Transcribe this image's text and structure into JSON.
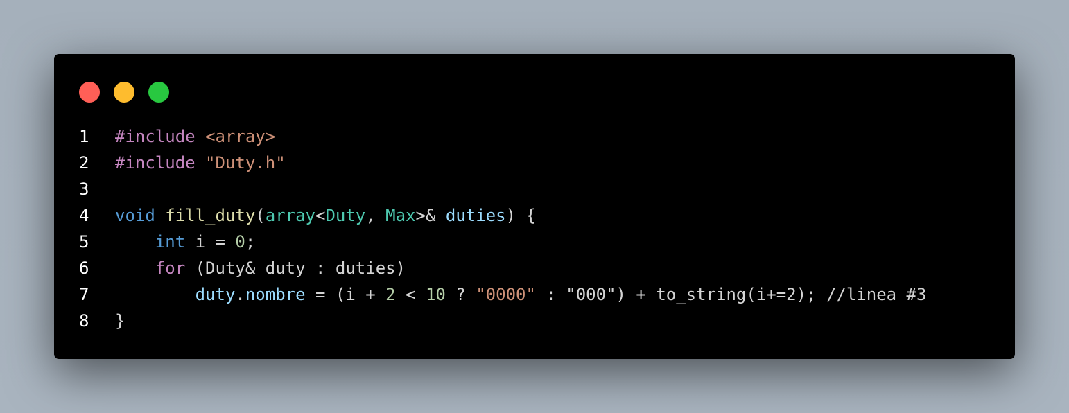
{
  "window": {
    "buttons": {
      "close_color": "#ff5f57",
      "minimize_color": "#febc2e",
      "maximize_color": "#28c840"
    }
  },
  "code": {
    "lines": [
      {
        "number": "1",
        "tokens": [
          {
            "text": "#include ",
            "color": "#c586c0"
          },
          {
            "text": "<array>",
            "color": "#ce9178"
          }
        ]
      },
      {
        "number": "2",
        "tokens": [
          {
            "text": "#include ",
            "color": "#c586c0"
          },
          {
            "text": "\"Duty.h\"",
            "color": "#ce9178"
          }
        ]
      },
      {
        "number": "3",
        "tokens": []
      },
      {
        "number": "4",
        "tokens": [
          {
            "text": "void",
            "color": "#569cd6"
          },
          {
            "text": " ",
            "color": "#d4d4d4"
          },
          {
            "text": "fill_duty",
            "color": "#dcdcaa"
          },
          {
            "text": "(",
            "color": "#d4d4d4"
          },
          {
            "text": "array",
            "color": "#4ec9b0"
          },
          {
            "text": "<",
            "color": "#d4d4d4"
          },
          {
            "text": "Duty",
            "color": "#4ec9b0"
          },
          {
            "text": ", ",
            "color": "#d4d4d4"
          },
          {
            "text": "Max",
            "color": "#4ec9b0"
          },
          {
            "text": ">&",
            "color": "#d4d4d4"
          },
          {
            "text": " ",
            "color": "#d4d4d4"
          },
          {
            "text": "duties",
            "color": "#9cdcfe"
          },
          {
            "text": ") {",
            "color": "#d4d4d4"
          }
        ]
      },
      {
        "number": "5",
        "tokens": [
          {
            "text": "    ",
            "color": "#d4d4d4"
          },
          {
            "text": "int",
            "color": "#569cd6"
          },
          {
            "text": " i = ",
            "color": "#d4d4d4"
          },
          {
            "text": "0",
            "color": "#b5cea8"
          },
          {
            "text": ";",
            "color": "#d4d4d4"
          }
        ]
      },
      {
        "number": "6",
        "tokens": [
          {
            "text": "    ",
            "color": "#d4d4d4"
          },
          {
            "text": "for",
            "color": "#c586c0"
          },
          {
            "text": " (Duty& duty : duties)",
            "color": "#d4d4d4"
          }
        ]
      },
      {
        "number": "7",
        "tokens": [
          {
            "text": "        ",
            "color": "#d4d4d4"
          },
          {
            "text": "duty",
            "color": "#9cdcfe"
          },
          {
            "text": ".",
            "color": "#d4d4d4"
          },
          {
            "text": "nombre",
            "color": "#9cdcfe"
          },
          {
            "text": " = (i + ",
            "color": "#d4d4d4"
          },
          {
            "text": "2",
            "color": "#b5cea8"
          },
          {
            "text": " < ",
            "color": "#d4d4d4"
          },
          {
            "text": "10",
            "color": "#b5cea8"
          },
          {
            "text": " ? ",
            "color": "#d4d4d4"
          },
          {
            "text": "\"0000\"",
            "color": "#ce9178"
          },
          {
            "text": " : \"000\") + to_string(i+=2); //linea #3",
            "color": "#d4d4d4"
          }
        ]
      },
      {
        "number": "8",
        "tokens": [
          {
            "text": "}",
            "color": "#d4d4d4"
          }
        ]
      }
    ]
  }
}
